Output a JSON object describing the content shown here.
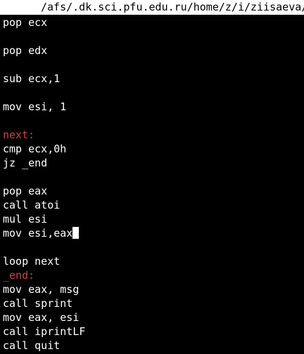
{
  "titlebar": {
    "path": "/afs/.dk.sci.pfu.edu.ru/home/z/i/ziisaeva/"
  },
  "colors": {
    "label": "#c8463f",
    "text": "#ffffff",
    "background": "#000000"
  },
  "editor": {
    "lines": [
      "pop ecx",
      "",
      "pop edx",
      "",
      "sub ecx,1",
      "",
      "mov esi, 1",
      "",
      "next:",
      "cmp ecx,0h",
      "jz _end",
      "",
      "pop eax",
      "call atoi",
      "mul esi",
      "mov esi,eax",
      "",
      "loop next",
      "_end:",
      "mov eax, msg",
      "call sprint",
      "mov eax, esi",
      "call iprintLF",
      "call quit"
    ]
  }
}
